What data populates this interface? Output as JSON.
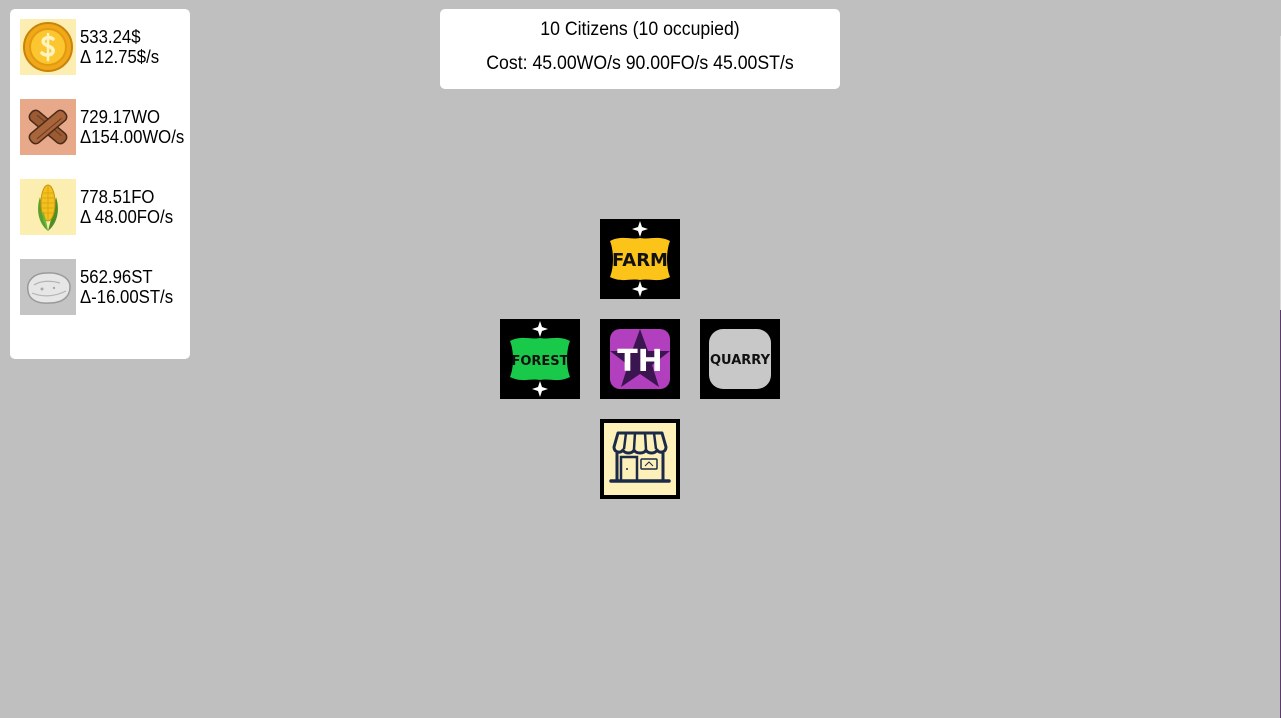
{
  "resources": {
    "gold": {
      "amount": "533.24$",
      "delta": "Δ 12.75$/s",
      "icon": "gold-coin-icon",
      "icon_bg": "#fbeeb0"
    },
    "wood": {
      "amount": "729.17WO",
      "delta": "Δ154.00WO/s",
      "icon": "wood-logs-icon",
      "icon_bg": "#e8a88a"
    },
    "food": {
      "amount": "778.51FO",
      "delta": "Δ 48.00FO/s",
      "icon": "corn-icon",
      "icon_bg": "#fbeeb0"
    },
    "stone": {
      "amount": "562.96ST",
      "delta": "Δ-16.00ST/s",
      "icon": "stone-icon",
      "icon_bg": "#c4c4c4"
    }
  },
  "citizens": {
    "summary": "10 Citizens (10 occupied)",
    "cost": "Cost: 45.00WO/s 90.00FO/s 45.00ST/s"
  },
  "buildings": {
    "farm": {
      "label": "FARM",
      "color": "#fcc419"
    },
    "forest": {
      "label": "FOREST",
      "color": "#19c94a"
    },
    "town_hall": {
      "label": "TH",
      "color": "#b23fbd"
    },
    "quarry": {
      "label": "QUARRY",
      "color": "#c8c8c8"
    },
    "market": {
      "label": "",
      "color": "#fdf0b8",
      "icon": "shop-icon"
    }
  }
}
